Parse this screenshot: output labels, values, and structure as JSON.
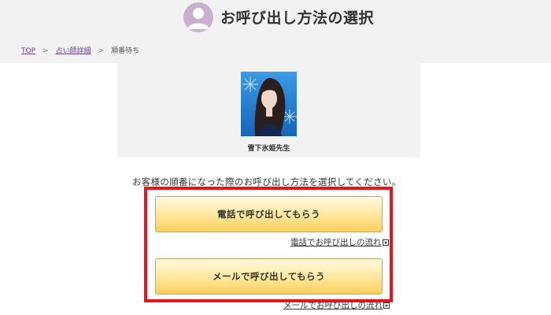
{
  "header": {
    "title": "お呼び出し方法の選択"
  },
  "breadcrumb": {
    "items": [
      "TOP",
      "占い師詳細",
      "順番待ち"
    ],
    "separator": ">"
  },
  "profile": {
    "name": "雪下氷姫先生"
  },
  "main": {
    "instruction": "お客様の順番になった際のお呼び出し方法を選択してください。",
    "phone_button_label": "電話で呼び出してもらう",
    "phone_flow_link": "電話でお呼び出しの流れ",
    "mail_button_label": "メールで呼び出してもらう",
    "mail_flow_link": "メールでお呼び出しの流れ"
  },
  "colors": {
    "highlight": "#e8141c",
    "button_gradient_top": "#fffae0",
    "button_gradient_bottom": "#f9cf5b",
    "link": "#6a3f8c",
    "avatar_bg": "#c9b0cf"
  },
  "icons": {
    "avatar": "user-icon",
    "flow_link": "dropdown-arrow-icon"
  }
}
